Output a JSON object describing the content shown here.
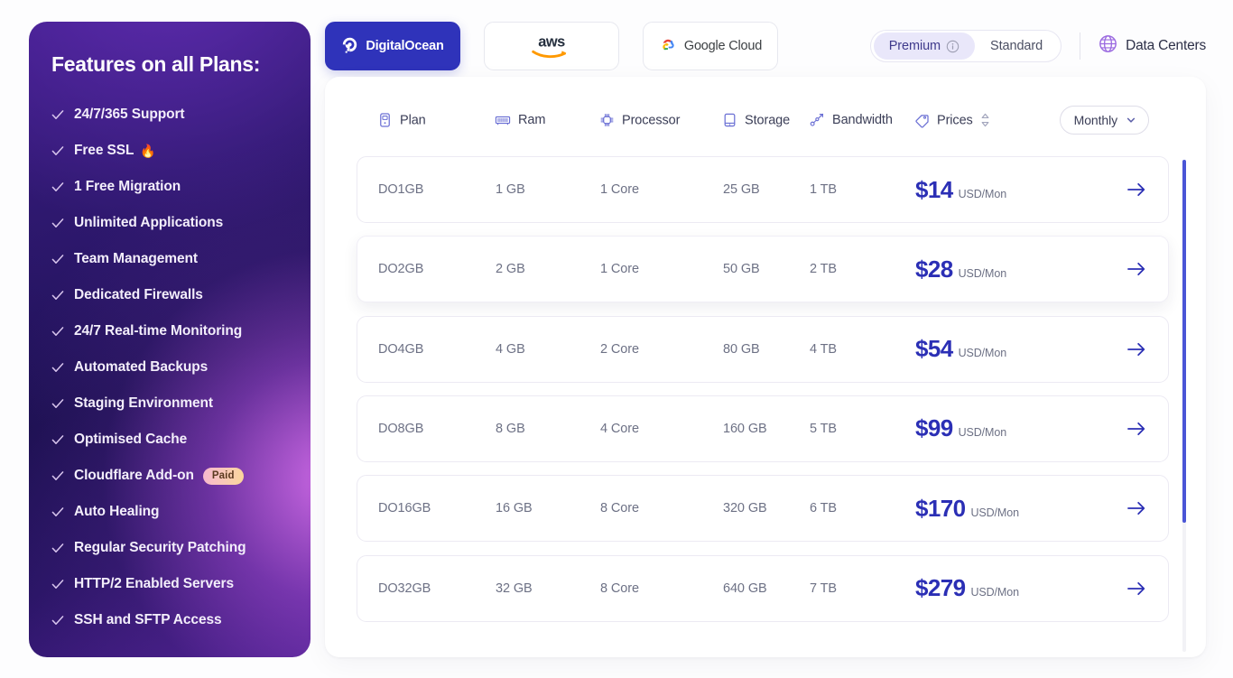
{
  "sidebar": {
    "title": "Features on all Plans:",
    "features": [
      {
        "label": "24/7/365 Support"
      },
      {
        "label": "Free SSL",
        "emoji": "🔥"
      },
      {
        "label": "1 Free Migration"
      },
      {
        "label": "Unlimited Applications"
      },
      {
        "label": "Team Management"
      },
      {
        "label": "Dedicated Firewalls"
      },
      {
        "label": "24/7 Real-time Monitoring"
      },
      {
        "label": "Automated Backups"
      },
      {
        "label": "Staging Environment"
      },
      {
        "label": "Optimised Cache"
      },
      {
        "label": "Cloudflare Add-on",
        "badge": "Paid"
      },
      {
        "label": "Auto Healing"
      },
      {
        "label": "Regular Security Patching"
      },
      {
        "label": "HTTP/2 Enabled Servers"
      },
      {
        "label": "SSH and SFTP Access"
      }
    ]
  },
  "providers": [
    {
      "id": "digitalocean",
      "label": "DigitalOcean",
      "icon": "digitalocean-logo",
      "active": true
    },
    {
      "id": "aws",
      "label": "aws",
      "icon": "aws-logo",
      "active": false
    },
    {
      "id": "googlecloud",
      "label": "Google Cloud",
      "icon": "google-cloud-logo",
      "active": false
    }
  ],
  "tier_toggle": {
    "premium_label": "Premium",
    "standard_label": "Standard",
    "selected": "Premium",
    "info_icon": "info-icon"
  },
  "data_centers": {
    "label": "Data Centers",
    "icon": "globe-icon"
  },
  "table": {
    "headers": [
      {
        "label": "Plan",
        "icon": "plan-icon"
      },
      {
        "label": "Ram",
        "icon": "ram-icon"
      },
      {
        "label": "Processor",
        "icon": "cpu-icon"
      },
      {
        "label": "Storage",
        "icon": "storage-icon"
      },
      {
        "label": "Bandwidth",
        "icon": "bandwidth-icon"
      },
      {
        "label": "Prices",
        "icon": "price-tag-icon",
        "sortable": true
      }
    ],
    "billing_select": {
      "value": "Monthly",
      "chevron": "chevron-down-icon"
    },
    "rows": [
      {
        "plan": "DO1GB",
        "ram": "1 GB",
        "processor": "1 Core",
        "storage": "25 GB",
        "bandwidth": "1 TB",
        "price": "$14",
        "price_unit": "USD/Mon",
        "highlighted": false
      },
      {
        "plan": "DO2GB",
        "ram": "2 GB",
        "processor": "1 Core",
        "storage": "50 GB",
        "bandwidth": "2 TB",
        "price": "$28",
        "price_unit": "USD/Mon",
        "highlighted": true
      },
      {
        "plan": "DO4GB",
        "ram": "4 GB",
        "processor": "2 Core",
        "storage": "80 GB",
        "bandwidth": "4 TB",
        "price": "$54",
        "price_unit": "USD/Mon",
        "highlighted": false
      },
      {
        "plan": "DO8GB",
        "ram": "8 GB",
        "processor": "4 Core",
        "storage": "160 GB",
        "bandwidth": "5 TB",
        "price": "$99",
        "price_unit": "USD/Mon",
        "highlighted": false
      },
      {
        "plan": "DO16GB",
        "ram": "16 GB",
        "processor": "8 Core",
        "storage": "320 GB",
        "bandwidth": "6 TB",
        "price": "$170",
        "price_unit": "USD/Mon",
        "highlighted": false
      },
      {
        "plan": "DO32GB",
        "ram": "32 GB",
        "processor": "8 Core",
        "storage": "640 GB",
        "bandwidth": "7 TB",
        "price": "$279",
        "price_unit": "USD/Mon",
        "highlighted": false
      }
    ],
    "row_action_icon": "arrow-right-icon"
  },
  "colors": {
    "accent_blue": "#2b2fb5",
    "tab_active_bg": "#2f33ba",
    "price_blue": "#2b2fb5",
    "scrollbar": "#4a55d6",
    "segment_active_bg": "#e9e7fa",
    "globe_purple": "#9b6ae0"
  }
}
